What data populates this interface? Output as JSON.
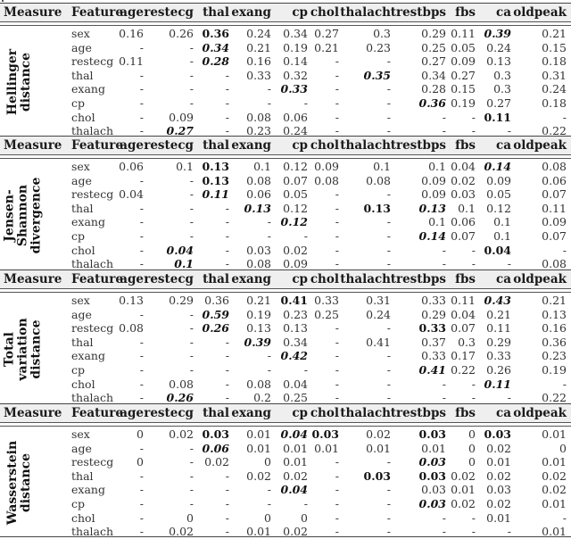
{
  "headers": {
    "measure": "Measure",
    "feature": "Feature",
    "columns": [
      "age",
      "restecg",
      "thal",
      "exang",
      "cp",
      "chol",
      "thalach",
      "trestbps",
      "fbs",
      "ca",
      "oldpeak"
    ]
  },
  "sections": [
    {
      "measure_lines": [
        "Hellinger",
        "distance"
      ],
      "rows": [
        {
          "feature": "sex",
          "values": [
            "0.16",
            "0.26",
            "0.36",
            "0.24",
            "0.34",
            "0.27",
            "0.3",
            "0.29",
            "0.11",
            "0.39",
            "0.21"
          ],
          "styles": [
            "",
            "",
            "b",
            "",
            "",
            "",
            "",
            "",
            "",
            "bi",
            ""
          ]
        },
        {
          "feature": "age",
          "values": [
            "-",
            "-",
            "0.34",
            "0.21",
            "0.19",
            "0.21",
            "0.23",
            "0.25",
            "0.05",
            "0.24",
            "0.15"
          ],
          "styles": [
            "",
            "",
            "bi",
            "",
            "",
            "",
            "",
            "",
            "",
            "",
            ""
          ]
        },
        {
          "feature": "restecg",
          "values": [
            "0.11",
            "-",
            "0.28",
            "0.16",
            "0.14",
            "-",
            "-",
            "0.27",
            "0.09",
            "0.13",
            "0.18"
          ],
          "styles": [
            "",
            "",
            "bi",
            "",
            "",
            "",
            "",
            "",
            "",
            "",
            ""
          ]
        },
        {
          "feature": "thal",
          "values": [
            "-",
            "-",
            "-",
            "0.33",
            "0.32",
            "-",
            "0.35",
            "0.34",
            "0.27",
            "0.3",
            "0.31"
          ],
          "styles": [
            "",
            "",
            "",
            "",
            "",
            "",
            "bi",
            "",
            "",
            "",
            ""
          ]
        },
        {
          "feature": "exang",
          "values": [
            "-",
            "-",
            "-",
            "-",
            "0.33",
            "-",
            "-",
            "0.28",
            "0.15",
            "0.3",
            "0.24"
          ],
          "styles": [
            "",
            "",
            "",
            "",
            "bi",
            "",
            "",
            "",
            "",
            "",
            ""
          ]
        },
        {
          "feature": "cp",
          "values": [
            "-",
            "-",
            "-",
            "-",
            "-",
            "-",
            "-",
            "0.36",
            "0.19",
            "0.27",
            "0.18"
          ],
          "styles": [
            "",
            "",
            "",
            "",
            "",
            "",
            "",
            "bi",
            "",
            "",
            ""
          ]
        },
        {
          "feature": "chol",
          "values": [
            "-",
            "0.09",
            "-",
            "0.08",
            "0.06",
            "-",
            "-",
            "-",
            "-",
            "0.11",
            "-"
          ],
          "styles": [
            "",
            "",
            "",
            "",
            "",
            "",
            "",
            "",
            "",
            "b",
            ""
          ]
        },
        {
          "feature": "thalach",
          "values": [
            "-",
            "0.27",
            "-",
            "0.23",
            "0.24",
            "-",
            "-",
            "-",
            "-",
            "-",
            "0.22"
          ],
          "styles": [
            "",
            "bi",
            "",
            "",
            "",
            "",
            "",
            "",
            "",
            "",
            ""
          ]
        }
      ]
    },
    {
      "measure_lines": [
        "Jensen-",
        "Shannon",
        "divergence"
      ],
      "rows": [
        {
          "feature": "sex",
          "values": [
            "0.06",
            "0.1",
            "0.13",
            "0.1",
            "0.12",
            "0.09",
            "0.1",
            "0.1",
            "0.04",
            "0.14",
            "0.08"
          ],
          "styles": [
            "",
            "",
            "b",
            "",
            "",
            "",
            "",
            "",
            "",
            "bi",
            ""
          ]
        },
        {
          "feature": "age",
          "values": [
            "-",
            "-",
            "0.13",
            "0.08",
            "0.07",
            "0.08",
            "0.08",
            "0.09",
            "0.02",
            "0.09",
            "0.06"
          ],
          "styles": [
            "",
            "",
            "b",
            "",
            "",
            "",
            "",
            "",
            "",
            "",
            ""
          ]
        },
        {
          "feature": "restecg",
          "values": [
            "0.04",
            "-",
            "0.11",
            "0.06",
            "0.05",
            "-",
            "-",
            "0.09",
            "0.03",
            "0.05",
            "0.07"
          ],
          "styles": [
            "",
            "",
            "bi",
            "",
            "",
            "",
            "",
            "",
            "",
            "",
            ""
          ]
        },
        {
          "feature": "thal",
          "values": [
            "-",
            "-",
            "-",
            "0.13",
            "0.12",
            "-",
            "0.13",
            "0.13",
            "0.1",
            "0.12",
            "0.11"
          ],
          "styles": [
            "",
            "",
            "",
            "bi",
            "",
            "",
            "b",
            "bi",
            "",
            "",
            ""
          ]
        },
        {
          "feature": "exang",
          "values": [
            "-",
            "-",
            "-",
            "-",
            "0.12",
            "-",
            "-",
            "0.1",
            "0.06",
            "0.1",
            "0.09"
          ],
          "styles": [
            "",
            "",
            "",
            "",
            "bi",
            "",
            "",
            "",
            "",
            "",
            ""
          ]
        },
        {
          "feature": "cp",
          "values": [
            "-",
            "-",
            "-",
            "-",
            "-",
            "-",
            "-",
            "0.14",
            "0.07",
            "0.1",
            "0.07"
          ],
          "styles": [
            "",
            "",
            "",
            "",
            "",
            "",
            "",
            "bi",
            "",
            "",
            ""
          ]
        },
        {
          "feature": "chol",
          "values": [
            "-",
            "0.04",
            "-",
            "0.03",
            "0.02",
            "-",
            "-",
            "-",
            "-",
            "0.04",
            "-"
          ],
          "styles": [
            "",
            "bi",
            "",
            "",
            "",
            "",
            "",
            "",
            "",
            "b",
            ""
          ]
        },
        {
          "feature": "thalach",
          "values": [
            "-",
            "0.1",
            "-",
            "0.08",
            "0.09",
            "-",
            "-",
            "-",
            "-",
            "-",
            "0.08"
          ],
          "styles": [
            "",
            "bi",
            "",
            "",
            "",
            "",
            "",
            "",
            "",
            "",
            ""
          ]
        }
      ]
    },
    {
      "measure_lines": [
        "Total",
        "variation",
        "distance"
      ],
      "rows": [
        {
          "feature": "sex",
          "values": [
            "0.13",
            "0.29",
            "0.36",
            "0.21",
            "0.41",
            "0.33",
            "0.31",
            "0.33",
            "0.11",
            "0.43",
            "0.21"
          ],
          "styles": [
            "",
            "",
            "",
            "",
            "b",
            "",
            "",
            "",
            "",
            "bi",
            ""
          ]
        },
        {
          "feature": "age",
          "values": [
            "-",
            "-",
            "0.59",
            "0.19",
            "0.23",
            "0.25",
            "0.24",
            "0.29",
            "0.04",
            "0.21",
            "0.13"
          ],
          "styles": [
            "",
            "",
            "bi",
            "",
            "",
            "",
            "",
            "",
            "",
            "",
            ""
          ]
        },
        {
          "feature": "restecg",
          "values": [
            "0.08",
            "-",
            "0.26",
            "0.13",
            "0.13",
            "-",
            "-",
            "0.33",
            "0.07",
            "0.11",
            "0.16"
          ],
          "styles": [
            "",
            "",
            "bi",
            "",
            "",
            "",
            "",
            "b",
            "",
            "",
            ""
          ]
        },
        {
          "feature": "thal",
          "values": [
            "-",
            "-",
            "-",
            "0.39",
            "0.34",
            "-",
            "0.41",
            "0.37",
            "0.3",
            "0.29",
            "0.36"
          ],
          "styles": [
            "",
            "",
            "",
            "bi",
            "",
            "",
            "",
            "",
            "",
            "",
            ""
          ]
        },
        {
          "feature": "exang",
          "values": [
            "-",
            "-",
            "-",
            "-",
            "0.42",
            "-",
            "-",
            "0.33",
            "0.17",
            "0.33",
            "0.23"
          ],
          "styles": [
            "",
            "",
            "",
            "",
            "bi",
            "",
            "",
            "",
            "",
            "",
            ""
          ]
        },
        {
          "feature": "cp",
          "values": [
            "-",
            "-",
            "-",
            "-",
            "-",
            "-",
            "-",
            "0.41",
            "0.22",
            "0.26",
            "0.19"
          ],
          "styles": [
            "",
            "",
            "",
            "",
            "",
            "",
            "",
            "bi",
            "",
            "",
            ""
          ]
        },
        {
          "feature": "chol",
          "values": [
            "-",
            "0.08",
            "-",
            "0.08",
            "0.04",
            "-",
            "-",
            "-",
            "-",
            "0.11",
            "-"
          ],
          "styles": [
            "",
            "",
            "",
            "",
            "",
            "",
            "",
            "",
            "",
            "bi",
            ""
          ]
        },
        {
          "feature": "thalach",
          "values": [
            "-",
            "0.26",
            "-",
            "0.2",
            "0.25",
            "-",
            "-",
            "-",
            "-",
            "-",
            "0.22"
          ],
          "styles": [
            "",
            "bi",
            "",
            "",
            "",
            "",
            "",
            "",
            "",
            "",
            ""
          ]
        }
      ]
    },
    {
      "measure_lines": [
        "Wasserstein",
        "distance"
      ],
      "rows": [
        {
          "feature": "sex",
          "values": [
            "0",
            "0.02",
            "0.03",
            "0.01",
            "0.04",
            "0.03",
            "0.02",
            "0.03",
            "0",
            "0.03",
            "0.01"
          ],
          "styles": [
            "",
            "",
            "b",
            "",
            "bi",
            "b",
            "",
            "b",
            "",
            "b",
            ""
          ]
        },
        {
          "feature": "age",
          "values": [
            "-",
            "-",
            "0.06",
            "0.01",
            "0.01",
            "0.01",
            "0.01",
            "0.01",
            "0",
            "0.02",
            "0"
          ],
          "styles": [
            "",
            "",
            "bi",
            "",
            "",
            "",
            "",
            "",
            "",
            "",
            ""
          ]
        },
        {
          "feature": "restecg",
          "values": [
            "0",
            "-",
            "0.02",
            "0",
            "0.01",
            "-",
            "-",
            "0.03",
            "0",
            "0.01",
            "0.01"
          ],
          "styles": [
            "",
            "",
            "",
            "",
            "",
            "",
            "",
            "bi",
            "",
            "",
            ""
          ]
        },
        {
          "feature": "thal",
          "values": [
            "-",
            "-",
            "-",
            "0.02",
            "0.02",
            "-",
            "0.03",
            "0.03",
            "0.02",
            "0.02",
            "0.02"
          ],
          "styles": [
            "",
            "",
            "",
            "",
            "",
            "",
            "b",
            "b",
            "",
            "",
            ""
          ]
        },
        {
          "feature": "exang",
          "values": [
            "-",
            "-",
            "-",
            "-",
            "0.04",
            "-",
            "-",
            "0.03",
            "0.01",
            "0.03",
            "0.02"
          ],
          "styles": [
            "",
            "",
            "",
            "",
            "bi",
            "",
            "",
            "",
            "",
            "",
            ""
          ]
        },
        {
          "feature": "cp",
          "values": [
            "-",
            "-",
            "-",
            "-",
            "-",
            "-",
            "-",
            "0.03",
            "0.02",
            "0.02",
            "0.01"
          ],
          "styles": [
            "",
            "",
            "",
            "",
            "",
            "",
            "",
            "bi",
            "",
            "",
            ""
          ]
        },
        {
          "feature": "chol",
          "values": [
            "-",
            "0",
            "-",
            "0",
            "0",
            "-",
            "-",
            "-",
            "-",
            "0.01",
            "-"
          ],
          "styles": [
            "",
            "",
            "",
            "",
            "",
            "",
            "",
            "",
            "",
            "",
            ""
          ]
        },
        {
          "feature": "thalach",
          "values": [
            "-",
            "0.02",
            "-",
            "0.01",
            "0.02",
            "-",
            "-",
            "-",
            "-",
            "-",
            "0.01"
          ],
          "styles": [
            "",
            "",
            "",
            "",
            "",
            "",
            "",
            "",
            "",
            "",
            ""
          ]
        }
      ]
    }
  ]
}
